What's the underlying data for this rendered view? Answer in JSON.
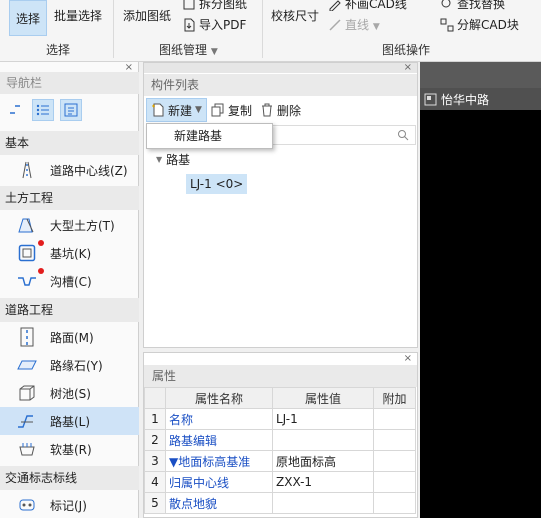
{
  "ribbon": {
    "select_label": "选择",
    "batch_select_label": "批量选择",
    "select_group": "选择",
    "add_drawing_label": "添加图纸",
    "split_drawing_label": "拆分图纸",
    "import_pdf_label": "导入PDF",
    "drawing_mgmt_group": "图纸管理",
    "check_size_label": "校核尺寸",
    "fill_cad_label": "补画CAD线",
    "line_label": "直线",
    "find_replace_label": "查找替换",
    "explode_cad_label": "分解CAD块",
    "drawing_ops_group": "图纸操作"
  },
  "nav": {
    "title": "导航栏",
    "close": "×",
    "categories": [
      {
        "label": "基本",
        "items": [
          {
            "label": "道路中心线(Z)",
            "icon": "road-centerline-icon"
          }
        ]
      },
      {
        "label": "土方工程",
        "items": [
          {
            "label": "大型土方(T)",
            "icon": "earthwork-icon"
          },
          {
            "label": "基坑(K)",
            "icon": "foundation-pit-icon",
            "dot": true
          },
          {
            "label": "沟槽(C)",
            "icon": "trench-icon",
            "dot": true
          }
        ]
      },
      {
        "label": "道路工程",
        "items": [
          {
            "label": "路面(M)",
            "icon": "pavement-icon"
          },
          {
            "label": "路缘石(Y)",
            "icon": "curb-icon"
          },
          {
            "label": "树池(S)",
            "icon": "tree-pit-icon"
          },
          {
            "label": "路基(L)",
            "icon": "subgrade-icon",
            "active": true
          },
          {
            "label": "软基(R)",
            "icon": "soft-foundation-icon"
          }
        ]
      },
      {
        "label": "交通标志标线",
        "items": [
          {
            "label": "标记(J)",
            "icon": "marking-icon"
          }
        ]
      }
    ]
  },
  "components": {
    "title": "构件列表",
    "close": "×",
    "new_label": "新建",
    "copy_label": "复制",
    "delete_label": "删除",
    "tree_root": "路基",
    "tree_leaf": "LJ-1 <0>",
    "dropdown_item": "新建路基"
  },
  "properties": {
    "title": "属性",
    "close": "×",
    "headers": [
      "属性名称",
      "属性值",
      "附加"
    ],
    "rows": [
      {
        "index": "1",
        "name": "名称",
        "value": "LJ-1"
      },
      {
        "index": "2",
        "name": "路基编辑",
        "value": ""
      },
      {
        "index": "3",
        "name": "▼地面标高基准",
        "value": "原地面标高"
      },
      {
        "index": "4",
        "name": "归属中心线",
        "value": "ZXX-1"
      },
      {
        "index": "5",
        "name": "散点地貌",
        "value": ""
      }
    ]
  },
  "canvas": {
    "tab_label": "怡华中路"
  },
  "colors": {
    "accent": "#1a4fc4",
    "selected": "#cde4f7",
    "dot": "#e21d1d"
  }
}
